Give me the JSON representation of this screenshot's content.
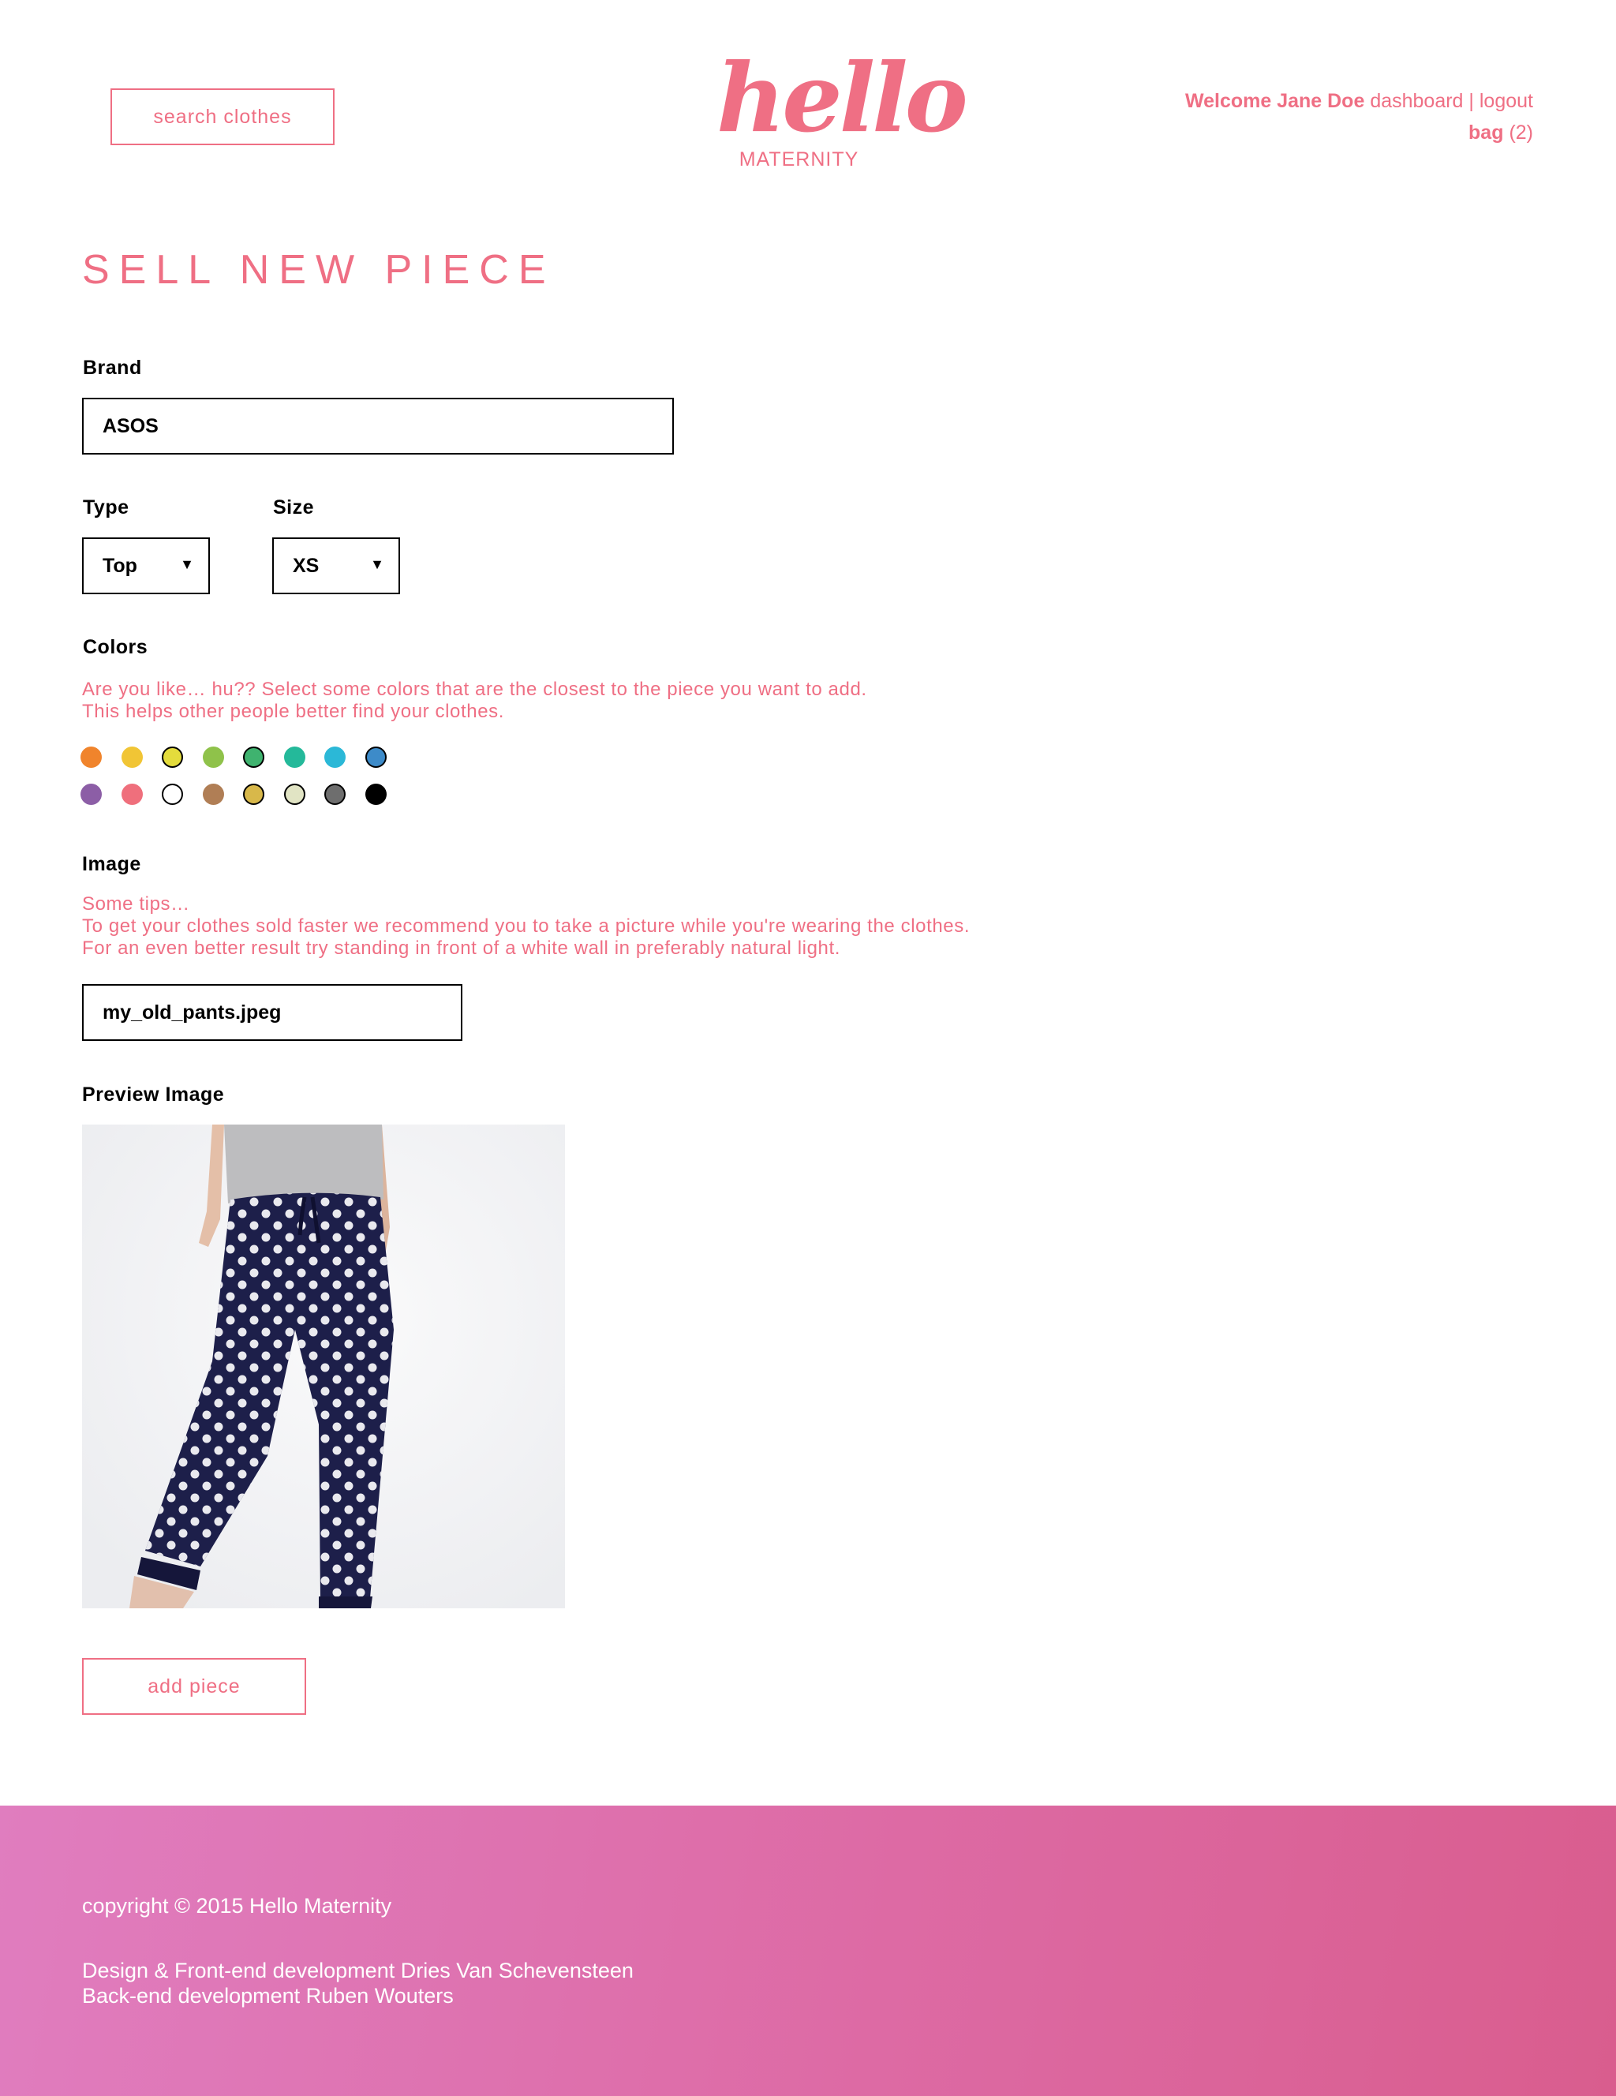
{
  "header": {
    "search_label": "search clothes",
    "logo_word": "hello",
    "logo_sub": "MATERNITY",
    "welcome_prefix": "Welcome Jane Doe",
    "dashboard_label": "dashboard",
    "separator": "|",
    "logout_label": "logout",
    "bag_label": "bag",
    "bag_count": "(2)"
  },
  "main": {
    "title": "SELL NEW PIECE",
    "brand": {
      "label": "Brand",
      "value": "ASOS"
    },
    "type": {
      "label": "Type",
      "value": "Top"
    },
    "size": {
      "label": "Size",
      "value": "XS"
    },
    "colors": {
      "label": "Colors",
      "help_line1": "Are you like… hu?? Select some colors that are the closest to the piece you want to add.",
      "help_line2": "This helps other people better find your clothes.",
      "swatches": [
        {
          "color": "#f0842c",
          "selected": false
        },
        {
          "color": "#f1c535",
          "selected": false
        },
        {
          "color": "#e4dc3c",
          "selected": true
        },
        {
          "color": "#8fc24a",
          "selected": false
        },
        {
          "color": "#3fb36f",
          "selected": true
        },
        {
          "color": "#24b99a",
          "selected": false
        },
        {
          "color": "#2bb8d7",
          "selected": false
        },
        {
          "color": "#3d8bc9",
          "selected": true
        },
        {
          "color": "#8c5ea6",
          "selected": false
        },
        {
          "color": "#ef6f7c",
          "selected": false
        },
        {
          "color": "#ffffff",
          "selected": true
        },
        {
          "color": "#b07e55",
          "selected": false
        },
        {
          "color": "#d8b84a",
          "selected": true
        },
        {
          "color": "#e1e4c4",
          "selected": true
        },
        {
          "color": "#6e6e6e",
          "selected": true
        },
        {
          "color": "#000000",
          "selected": false
        }
      ]
    },
    "image": {
      "label": "Image",
      "tip_line1": "Some tips…",
      "tip_line2": "To get your clothes sold faster we recommend you to take a picture while you're wearing the clothes.",
      "tip_line3": "For an even better result try standing in front of a white wall in preferably natural light.",
      "file_value": "my_old_pants.jpeg"
    },
    "preview_label": "Preview Image",
    "add_label": "add piece"
  },
  "footer": {
    "copyright": "copyright © 2015 Hello Maternity",
    "credit1": "Design & Front-end development Dries Van Schevensteen",
    "credit2": "Back-end development Ruben Wouters"
  },
  "colors": {
    "accent": "#ef6f84",
    "footer_start": "#e07dbf",
    "footer_end": "#d95d8e"
  }
}
